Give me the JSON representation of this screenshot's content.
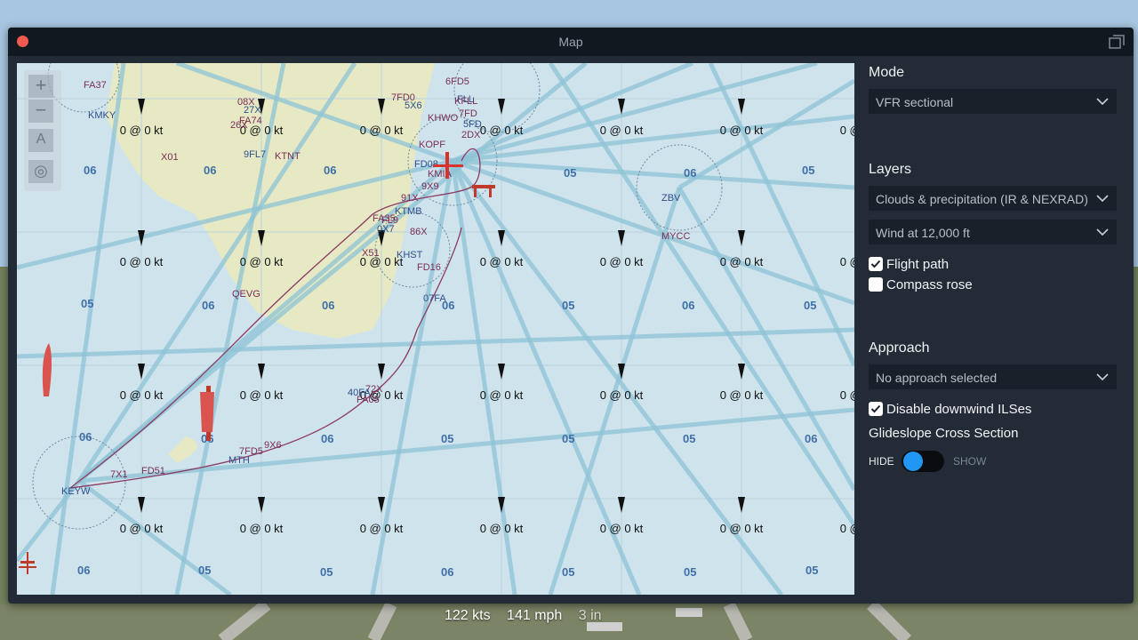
{
  "window": {
    "title": "Map"
  },
  "map": {
    "wind_readout": "0 @ 0 kt",
    "wind_readout_partial": "0 kt",
    "wind_readout_cut": "0",
    "sector_labels": [
      "06",
      "05"
    ],
    "airport_labels": [
      "FA37",
      "KMKY",
      "X01",
      "08X",
      "27X",
      "FA74",
      "26X",
      "9FL7",
      "KTNT",
      "7FD0",
      "5X6",
      "6FD5",
      "KHWO",
      "FLL",
      "KFLL",
      "7FD",
      "5FD",
      "2DX",
      "KOPF",
      "FD08",
      "KMIA",
      "9X9",
      "KTMB",
      "FA35",
      "91X",
      "0X7",
      "FL9",
      "86X",
      "KHST",
      "X51",
      "FD16",
      "07FA",
      "QEVG",
      "MYCC",
      "ZBV",
      "7X1",
      "FD51",
      "MTH",
      "7FD5",
      "9X6",
      "KEYW",
      "FA05",
      "72X",
      "40FA"
    ],
    "controls": {
      "zoom_in": "+",
      "zoom_out": "−",
      "north_up": "A",
      "locate": "◎"
    }
  },
  "panel": {
    "mode": {
      "heading": "Mode",
      "selected": "VFR sectional"
    },
    "layers": {
      "heading": "Layers",
      "weather_selected": "Clouds & precipitation (IR & NEXRAD)",
      "wind_selected": "Wind at 12,000 ft",
      "flight_path_label": "Flight path",
      "flight_path_checked": true,
      "compass_rose_label": "Compass rose",
      "compass_rose_checked": false
    },
    "approach": {
      "heading": "Approach",
      "selected": "No approach selected",
      "disable_downwind_label": "Disable downwind ILSes",
      "disable_downwind_checked": true,
      "glideslope_label": "Glideslope Cross Section",
      "toggle_hide": "HIDE",
      "toggle_show": "SHOW",
      "toggle_state": "hide"
    }
  },
  "status_bar": {
    "speed_kts": "122 kts",
    "speed_mph": "141 mph",
    "extra": "3 in"
  },
  "colors": {
    "toggle_accent": "#2196f3",
    "close_button": "#f05a4e",
    "flight_path": "#8b3a62",
    "airway": "#8ec3d6",
    "land": "#e6e9c4",
    "water": "#cfe3ec"
  }
}
